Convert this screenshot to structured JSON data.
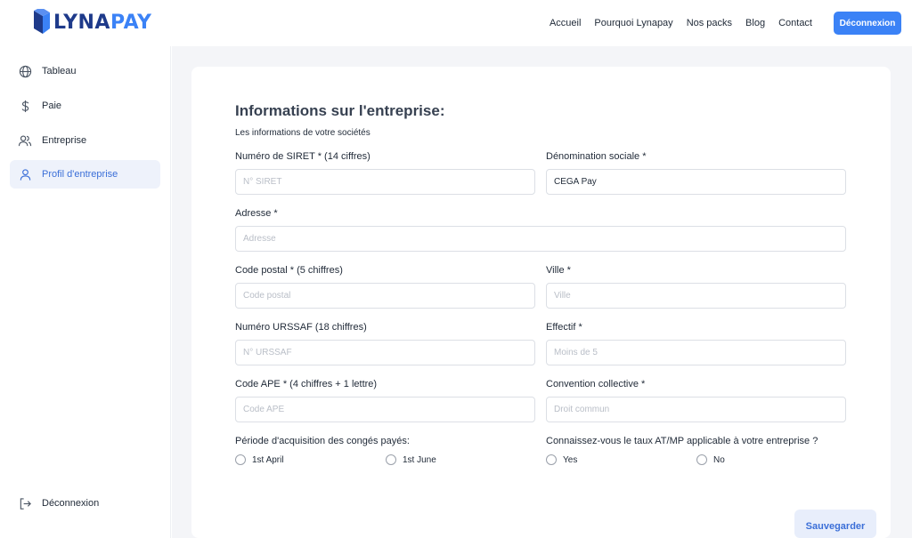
{
  "brand": {
    "part1": "LYNA",
    "part2": "PAY",
    "color_dark": "#1e3a8a",
    "color_accent": "#3b82f6"
  },
  "nav": {
    "items": [
      "Accueil",
      "Pourquoi Lynapay",
      "Nos packs",
      "Blog",
      "Contact"
    ],
    "logout_label": "Déconnexion"
  },
  "sidebar": {
    "items": [
      {
        "label": "Tableau",
        "icon": "globe-icon"
      },
      {
        "label": "Paie",
        "icon": "dollar-icon"
      },
      {
        "label": "Entreprise",
        "icon": "users-icon"
      },
      {
        "label": "Profil d'entreprise",
        "icon": "user-icon",
        "active": true
      }
    ],
    "logout": {
      "label": "Déconnexion",
      "icon": "logout-icon"
    }
  },
  "form": {
    "title": "Informations sur l'entreprise:",
    "subtitle": "Les informations de votre sociétés",
    "siret": {
      "label": "Numéro de SIRET * (14 ciffres)",
      "placeholder": "N° SIRET",
      "value": ""
    },
    "denomination": {
      "label": "Dénomination sociale *",
      "placeholder": "",
      "value": "CEGA Pay"
    },
    "adresse": {
      "label": "Adresse *",
      "placeholder": "Adresse",
      "value": ""
    },
    "code_postal": {
      "label": "Code postal * (5 chiffres)",
      "placeholder": "Code postal",
      "value": ""
    },
    "ville": {
      "label": "Ville *",
      "placeholder": "Ville",
      "value": ""
    },
    "urssaf": {
      "label": "Numéro URSSAF (18 chiffres)",
      "placeholder": "N° URSSAF",
      "value": ""
    },
    "effectif": {
      "label": "Effectif *",
      "placeholder": "Moins de 5",
      "value": ""
    },
    "ape": {
      "label": "Code APE * (4 chiffres + 1 lettre)",
      "placeholder": "Code APE",
      "value": ""
    },
    "convention": {
      "label": "Convention collective *",
      "placeholder": "Droit commun",
      "value": ""
    },
    "conges": {
      "label": "Période d'acquisition des congés payés:",
      "options": [
        "1st April",
        "1st June"
      ]
    },
    "atmp": {
      "label": "Connaissez-vous le taux AT/MP applicable à votre entreprise ?",
      "options": [
        "Yes",
        "No"
      ]
    },
    "save_label": "Sauvegarder"
  }
}
